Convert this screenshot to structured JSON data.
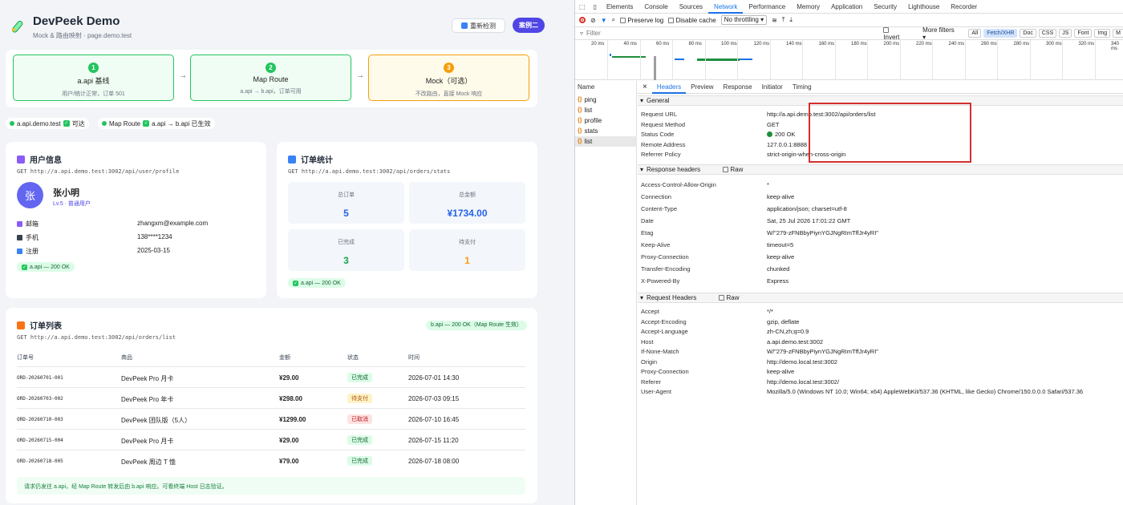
{
  "app": {
    "title": "DevPeek Demo",
    "subtitle": "Mock & 路由映射 · page.demo.test",
    "recheck_label": "重新检测",
    "case_label": "案例二",
    "steps": [
      {
        "num": "1",
        "title": "a.api 基线",
        "desc": "用户/统计正常，订单 501"
      },
      {
        "num": "2",
        "title": "Map Route",
        "desc": "a.api → b.api，订单可用"
      },
      {
        "num": "3",
        "title": "Mock（可选）",
        "desc": "不改路由，直接 Mock 响应"
      }
    ],
    "arrow": "→",
    "status": [
      {
        "host": "a.api.demo.test",
        "text": "可达"
      },
      {
        "host": "Map Route",
        "text": "a.api → b.api 已生效"
      }
    ],
    "user_card": {
      "title": "用户信息",
      "endpoint": "GET http://a.api.demo.test:3002/api/user/profile",
      "avatar": "张",
      "name": "张小明",
      "level": "Lv.5 · 普通用户",
      "rows": [
        {
          "k": "邮箱",
          "v": "zhangxm@example.com"
        },
        {
          "k": "手机",
          "v": "138****1234"
        },
        {
          "k": "注册",
          "v": "2025-03-15"
        }
      ],
      "badge": "a.api — 200 OK"
    },
    "stats_card": {
      "title": "订单统计",
      "endpoint": "GET http://a.api.demo.test:3002/api/orders/stats",
      "tiles": [
        {
          "label": "总订单",
          "value": "5",
          "color": "#2563eb"
        },
        {
          "label": "总金额",
          "value": "¥1734.00",
          "color": "#2563eb"
        },
        {
          "label": "已完成",
          "value": "3",
          "color": "#16a34a"
        },
        {
          "label": "待支付",
          "value": "1",
          "color": "#f59e0b"
        }
      ],
      "badge": "a.api — 200 OK"
    },
    "orders_card": {
      "title": "订单列表",
      "endpoint": "GET http://a.api.demo.test:3002/api/orders/list",
      "badge": "b.api — 200 OK（Map Route 生效）",
      "headers": [
        "订单号",
        "商品",
        "金额",
        "状态",
        "时间"
      ],
      "rows": [
        {
          "id": "ORD-20260701-001",
          "item": "DevPeek Pro 月卡",
          "amount": "¥29.00",
          "status": "已完成",
          "kind": "done",
          "time": "2026-07-01 14:30"
        },
        {
          "id": "ORD-20260703-002",
          "item": "DevPeek Pro 年卡",
          "amount": "¥298.00",
          "status": "待支付",
          "kind": "wait",
          "time": "2026-07-03 09:15"
        },
        {
          "id": "ORD-20260710-003",
          "item": "DevPeek 团队版（5人）",
          "amount": "¥1299.00",
          "status": "已取消",
          "kind": "cancel",
          "time": "2026-07-10 16:45"
        },
        {
          "id": "ORD-20260715-004",
          "item": "DevPeek Pro 月卡",
          "amount": "¥29.00",
          "status": "已完成",
          "kind": "done",
          "time": "2026-07-15 11:20"
        },
        {
          "id": "ORD-20260718-005",
          "item": "DevPeek 周边 T 恤",
          "amount": "¥79.00",
          "status": "已完成",
          "kind": "done",
          "time": "2026-07-18 08:00"
        }
      ],
      "note": "请求仍发往 a.api，经 Map Route 转发后由 b.api 响应。可看终端 Host 日志验证。"
    }
  },
  "devtools": {
    "tabs": [
      "Elements",
      "Console",
      "Sources",
      "Network",
      "Performance",
      "Memory",
      "Application",
      "Security",
      "Lighthouse",
      "Recorder"
    ],
    "active_tab": "Network",
    "preserve_log": "Preserve log",
    "disable_cache": "Disable cache",
    "throttling": "No throttling",
    "filter_placeholder": "Filter",
    "invert": "Invert",
    "more_filters": "More filters",
    "filter_types": [
      "All",
      "Fetch/XHR",
      "Doc",
      "CSS",
      "JS",
      "Font",
      "Img",
      "M"
    ],
    "ticks": [
      "20 ms",
      "40 ms",
      "60 ms",
      "80 ms",
      "100 ms",
      "120 ms",
      "140 ms",
      "160 ms",
      "180 ms",
      "200 ms",
      "220 ms",
      "240 ms",
      "260 ms",
      "280 ms",
      "300 ms",
      "320 ms",
      "340 ms"
    ],
    "name_header": "Name",
    "requests": [
      "ping",
      "list",
      "profile",
      "stats",
      "list"
    ],
    "detail_tabs": [
      "Headers",
      "Preview",
      "Response",
      "Initiator",
      "Timing"
    ],
    "general_label": "General",
    "general": [
      {
        "k": "Request URL",
        "v": "http://a.api.demo.test:3002/api/orders/list"
      },
      {
        "k": "Request Method",
        "v": "GET"
      },
      {
        "k": "Status Code",
        "v": "200 OK"
      },
      {
        "k": "Remote Address",
        "v": "127.0.0.1:8888"
      },
      {
        "k": "Referrer Policy",
        "v": "strict-origin-when-cross-origin"
      }
    ],
    "response_label": "Response headers",
    "raw": "Raw",
    "response_headers": [
      {
        "k": "Access-Control-Allow-Origin",
        "v": "*"
      },
      {
        "k": "Connection",
        "v": "keep-alive"
      },
      {
        "k": "Content-Type",
        "v": "application/json; charset=utf-8"
      },
      {
        "k": "Date",
        "v": "Sat, 25 Jul 2026 17:01:22 GMT"
      },
      {
        "k": "Etag",
        "v": "W/\"279-zFNBbyPiynYGJNgRImTffJr4yRI\""
      },
      {
        "k": "Keep-Alive",
        "v": "timeout=5"
      },
      {
        "k": "Proxy-Connection",
        "v": "keep-alive"
      },
      {
        "k": "Transfer-Encoding",
        "v": "chunked"
      },
      {
        "k": "X-Powered-By",
        "v": "Express"
      }
    ],
    "request_label": "Request Headers",
    "request_headers": [
      {
        "k": "Accept",
        "v": "*/*"
      },
      {
        "k": "Accept-Encoding",
        "v": "gzip, deflate"
      },
      {
        "k": "Accept-Language",
        "v": "zh-CN,zh;q=0.9"
      },
      {
        "k": "Host",
        "v": "a.api.demo.test:3002"
      },
      {
        "k": "If-None-Match",
        "v": "W/\"279-zFNBbyPiynYGJNgRImTffJr4yRI\""
      },
      {
        "k": "Origin",
        "v": "http://demo.local.test:3002"
      },
      {
        "k": "Proxy-Connection",
        "v": "keep-alive"
      },
      {
        "k": "Referer",
        "v": "http://demo.local.test:3002/"
      },
      {
        "k": "User-Agent",
        "v": "Mozilla/5.0 (Windows NT 10.0; Win64; x64) AppleWebKit/537.36 (KHTML, like Gecko) Chrome/150.0.0.0 Safari/537.36"
      }
    ]
  }
}
